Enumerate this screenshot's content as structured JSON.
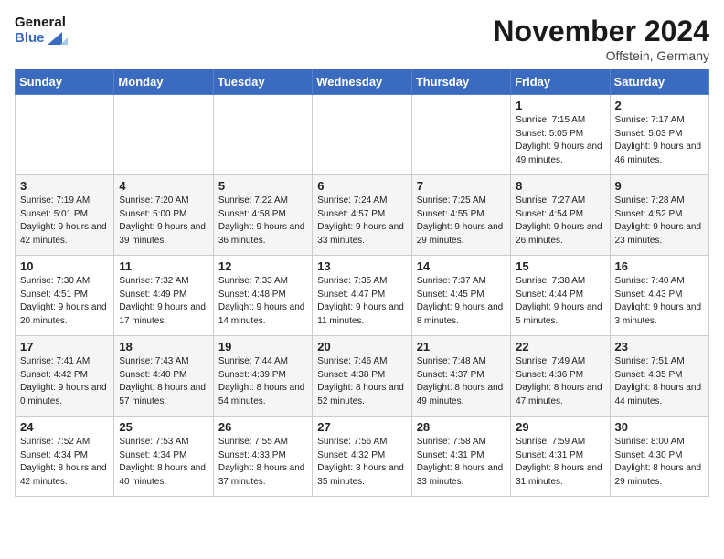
{
  "header": {
    "logo_general": "General",
    "logo_blue": "Blue",
    "month": "November 2024",
    "location": "Offstein, Germany"
  },
  "weekdays": [
    "Sunday",
    "Monday",
    "Tuesday",
    "Wednesday",
    "Thursday",
    "Friday",
    "Saturday"
  ],
  "weeks": [
    [
      {
        "day": "",
        "info": ""
      },
      {
        "day": "",
        "info": ""
      },
      {
        "day": "",
        "info": ""
      },
      {
        "day": "",
        "info": ""
      },
      {
        "day": "",
        "info": ""
      },
      {
        "day": "1",
        "info": "Sunrise: 7:15 AM\nSunset: 5:05 PM\nDaylight: 9 hours and 49 minutes."
      },
      {
        "day": "2",
        "info": "Sunrise: 7:17 AM\nSunset: 5:03 PM\nDaylight: 9 hours and 46 minutes."
      }
    ],
    [
      {
        "day": "3",
        "info": "Sunrise: 7:19 AM\nSunset: 5:01 PM\nDaylight: 9 hours and 42 minutes."
      },
      {
        "day": "4",
        "info": "Sunrise: 7:20 AM\nSunset: 5:00 PM\nDaylight: 9 hours and 39 minutes."
      },
      {
        "day": "5",
        "info": "Sunrise: 7:22 AM\nSunset: 4:58 PM\nDaylight: 9 hours and 36 minutes."
      },
      {
        "day": "6",
        "info": "Sunrise: 7:24 AM\nSunset: 4:57 PM\nDaylight: 9 hours and 33 minutes."
      },
      {
        "day": "7",
        "info": "Sunrise: 7:25 AM\nSunset: 4:55 PM\nDaylight: 9 hours and 29 minutes."
      },
      {
        "day": "8",
        "info": "Sunrise: 7:27 AM\nSunset: 4:54 PM\nDaylight: 9 hours and 26 minutes."
      },
      {
        "day": "9",
        "info": "Sunrise: 7:28 AM\nSunset: 4:52 PM\nDaylight: 9 hours and 23 minutes."
      }
    ],
    [
      {
        "day": "10",
        "info": "Sunrise: 7:30 AM\nSunset: 4:51 PM\nDaylight: 9 hours and 20 minutes."
      },
      {
        "day": "11",
        "info": "Sunrise: 7:32 AM\nSunset: 4:49 PM\nDaylight: 9 hours and 17 minutes."
      },
      {
        "day": "12",
        "info": "Sunrise: 7:33 AM\nSunset: 4:48 PM\nDaylight: 9 hours and 14 minutes."
      },
      {
        "day": "13",
        "info": "Sunrise: 7:35 AM\nSunset: 4:47 PM\nDaylight: 9 hours and 11 minutes."
      },
      {
        "day": "14",
        "info": "Sunrise: 7:37 AM\nSunset: 4:45 PM\nDaylight: 9 hours and 8 minutes."
      },
      {
        "day": "15",
        "info": "Sunrise: 7:38 AM\nSunset: 4:44 PM\nDaylight: 9 hours and 5 minutes."
      },
      {
        "day": "16",
        "info": "Sunrise: 7:40 AM\nSunset: 4:43 PM\nDaylight: 9 hours and 3 minutes."
      }
    ],
    [
      {
        "day": "17",
        "info": "Sunrise: 7:41 AM\nSunset: 4:42 PM\nDaylight: 9 hours and 0 minutes."
      },
      {
        "day": "18",
        "info": "Sunrise: 7:43 AM\nSunset: 4:40 PM\nDaylight: 8 hours and 57 minutes."
      },
      {
        "day": "19",
        "info": "Sunrise: 7:44 AM\nSunset: 4:39 PM\nDaylight: 8 hours and 54 minutes."
      },
      {
        "day": "20",
        "info": "Sunrise: 7:46 AM\nSunset: 4:38 PM\nDaylight: 8 hours and 52 minutes."
      },
      {
        "day": "21",
        "info": "Sunrise: 7:48 AM\nSunset: 4:37 PM\nDaylight: 8 hours and 49 minutes."
      },
      {
        "day": "22",
        "info": "Sunrise: 7:49 AM\nSunset: 4:36 PM\nDaylight: 8 hours and 47 minutes."
      },
      {
        "day": "23",
        "info": "Sunrise: 7:51 AM\nSunset: 4:35 PM\nDaylight: 8 hours and 44 minutes."
      }
    ],
    [
      {
        "day": "24",
        "info": "Sunrise: 7:52 AM\nSunset: 4:34 PM\nDaylight: 8 hours and 42 minutes."
      },
      {
        "day": "25",
        "info": "Sunrise: 7:53 AM\nSunset: 4:34 PM\nDaylight: 8 hours and 40 minutes."
      },
      {
        "day": "26",
        "info": "Sunrise: 7:55 AM\nSunset: 4:33 PM\nDaylight: 8 hours and 37 minutes."
      },
      {
        "day": "27",
        "info": "Sunrise: 7:56 AM\nSunset: 4:32 PM\nDaylight: 8 hours and 35 minutes."
      },
      {
        "day": "28",
        "info": "Sunrise: 7:58 AM\nSunset: 4:31 PM\nDaylight: 8 hours and 33 minutes."
      },
      {
        "day": "29",
        "info": "Sunrise: 7:59 AM\nSunset: 4:31 PM\nDaylight: 8 hours and 31 minutes."
      },
      {
        "day": "30",
        "info": "Sunrise: 8:00 AM\nSunset: 4:30 PM\nDaylight: 8 hours and 29 minutes."
      }
    ]
  ]
}
